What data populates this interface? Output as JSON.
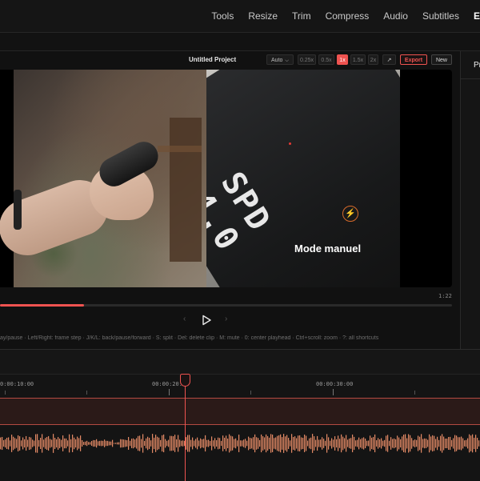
{
  "nav": {
    "items": [
      "Tools",
      "Resize",
      "Trim",
      "Compress",
      "Audio",
      "Subtitles"
    ],
    "active_partial": "E"
  },
  "editor": {
    "project_title": "Untitled Project",
    "quality_select": "Auto",
    "speeds": [
      "0.25x",
      "0.5x",
      "1x",
      "1.5x",
      "2x"
    ],
    "active_speed": "1x",
    "export_label": "Export",
    "new_label": "New"
  },
  "video": {
    "subtitle": "Mode manuel",
    "display_line1": "SPD",
    "display_line2": "4.0",
    "duration": "1:22",
    "progress": 0.185
  },
  "hints": "ay/pause · Left/Right: frame step · J/K/L: back/pause/forward · S: split · Del: delete clip · M: mute · 0: center playhead · Ctrl+scroll: zoom · ?: all shortcuts",
  "right_panel": {
    "label_partial": "Pr"
  },
  "timeline": {
    "tick_labels": [
      "0:00:10:00",
      "00:00:20:00",
      "00:00:30:00"
    ]
  },
  "colors": {
    "accent": "#ef5350",
    "background": "#121212"
  }
}
